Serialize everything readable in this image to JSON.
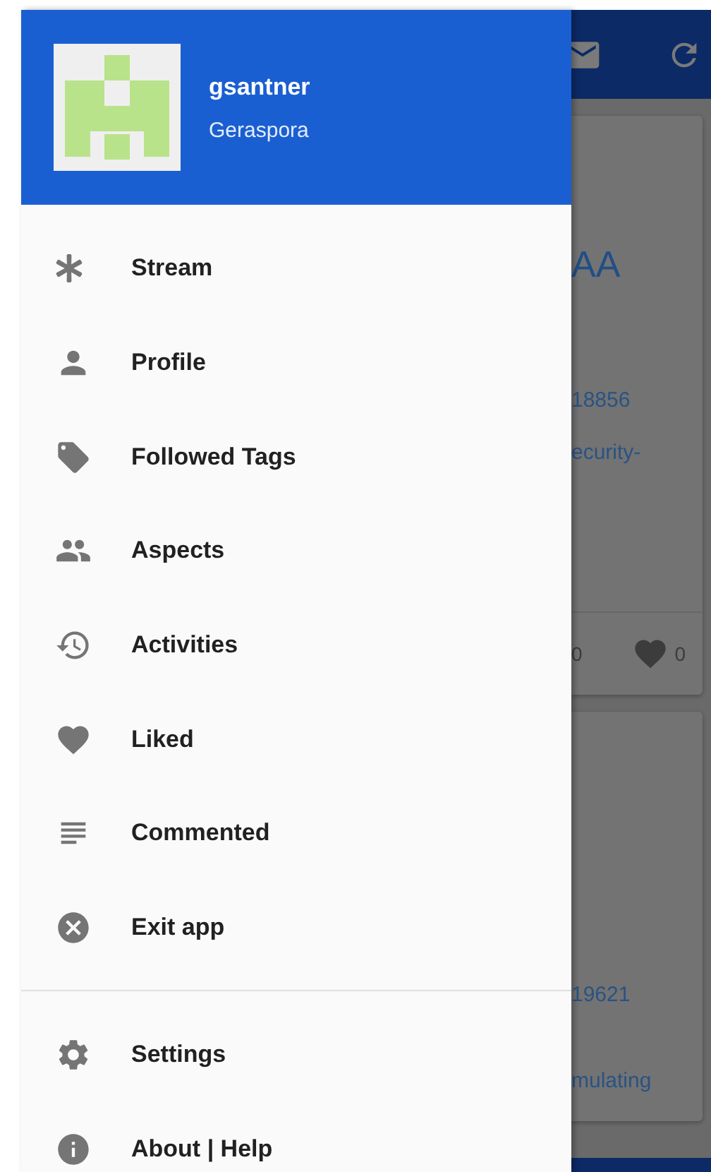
{
  "drawer": {
    "header": {
      "username": "gsantner",
      "pod": "Geraspora"
    },
    "items": [
      {
        "label": "Stream"
      },
      {
        "label": "Profile"
      },
      {
        "label": "Followed Tags"
      },
      {
        "label": "Aspects"
      },
      {
        "label": "Activities"
      },
      {
        "label": "Liked"
      },
      {
        "label": "Commented"
      },
      {
        "label": "Exit app"
      }
    ],
    "footer_items": [
      {
        "label": "Settings"
      },
      {
        "label": "About | Help"
      }
    ]
  },
  "background": {
    "cards": [
      {
        "title": "AA",
        "number": "18856",
        "text": "ecurity-",
        "comments": "0",
        "likes": "0"
      },
      {
        "number": "19621",
        "text": "mulating"
      }
    ]
  }
}
